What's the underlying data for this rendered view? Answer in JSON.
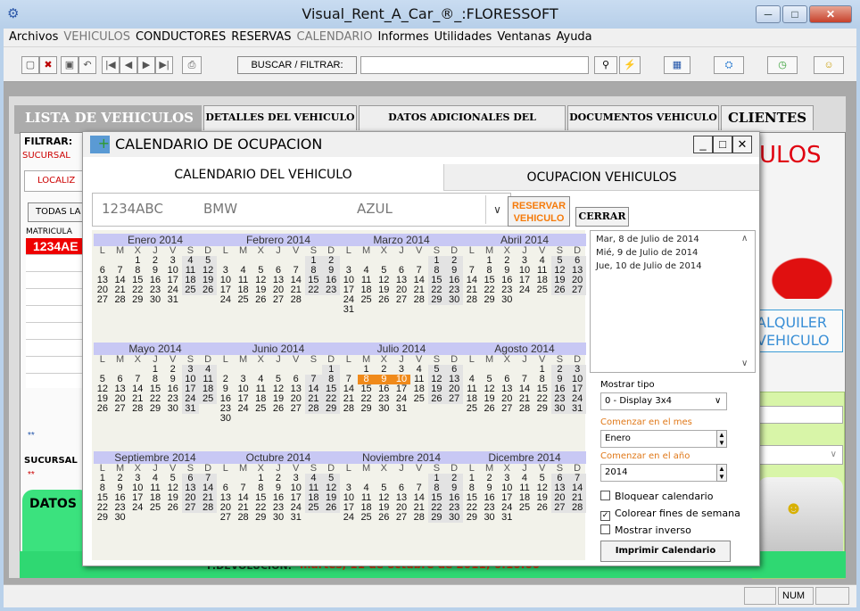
{
  "window": {
    "title": "Visual_Rent_A_Car_®_:FLORESSOFT",
    "min": "─",
    "max": "□",
    "close": "✕"
  },
  "menu": [
    {
      "label": "Archivos",
      "disabled": false
    },
    {
      "label": "VEHICULOS",
      "disabled": true
    },
    {
      "label": "CONDUCTORES",
      "disabled": false
    },
    {
      "label": "RESERVAS",
      "disabled": false
    },
    {
      "label": "CALENDARIO",
      "disabled": true
    },
    {
      "label": "Informes",
      "disabled": false
    },
    {
      "label": "Utilidades",
      "disabled": false
    },
    {
      "label": "Ventanas",
      "disabled": false
    },
    {
      "label": "Ayuda",
      "disabled": false
    }
  ],
  "toolbar": {
    "search_label": "BUSCAR / FILTRAR:",
    "search_value": ""
  },
  "tabs": {
    "main": "LISTA DE VEHICULOS",
    "t1": "DETALLES DEL VEHICULO",
    "t2": "DATOS ADICIONALES DEL VEHICULO",
    "t3": "DOCUMENTOS VEHICULO",
    "t4": "CLIENTES"
  },
  "left": {
    "filtrar": "FILTRAR:",
    "sucursal": "SUCURSAL",
    "localiz": "LOCALIZ",
    "todas": "TODAS LA",
    "matricula": "MATRICULA",
    "row1": "1234AE",
    "stars1": "**",
    "sucursal2": "SUCURSAL",
    "stars2": "**",
    "datos": "DATOS"
  },
  "right": {
    "title": "ULOS",
    "alquiler": "ALQUILER",
    "vehiculo": "VEHICULO"
  },
  "devolucion": {
    "label": "F.DEVOLUCION:",
    "value": "martes, 11 de octubre de 2011; 6:10:00"
  },
  "status": {
    "num": "NUM"
  },
  "dialog": {
    "title": "CALENDARIO DE OCUPACION",
    "tab1": "CALENDARIO DEL VEHICULO",
    "tab2": "OCUPACION VEHICULOS",
    "plate": "1234ABC",
    "brand": "BMW",
    "color": "AZUL",
    "reservar": "RESERVAR VEHICULO",
    "cerrar": "CERRAR",
    "dates": [
      "Mar, 8 de Julio de 2014",
      "Mié, 9 de Julio de 2014",
      "Jue, 10 de Julio de 2014"
    ],
    "mostrar_tipo": "Mostrar tipo",
    "display": "0 - Display 3x4",
    "comenzar_mes": "Comenzar en el mes",
    "mes": "Enero",
    "comenzar_anio": "Comenzar en el año",
    "anio": "2014",
    "bloquear": "Bloquear calendario",
    "colorear": "Colorear fines de semana",
    "inverso": "Mostrar inverso",
    "imprimir": "Imprimir Calendario",
    "weekdays": [
      "L",
      "M",
      "X",
      "J",
      "V",
      "S",
      "D"
    ],
    "months": [
      {
        "name": "Enero 2014",
        "offset": 2,
        "days": 31
      },
      {
        "name": "Febrero 2014",
        "offset": 5,
        "days": 28
      },
      {
        "name": "Marzo 2014",
        "offset": 5,
        "days": 31
      },
      {
        "name": "Abril 2014",
        "offset": 1,
        "days": 30
      },
      {
        "name": "Mayo 2014",
        "offset": 3,
        "days": 31
      },
      {
        "name": "Junio 2014",
        "offset": 6,
        "days": 30
      },
      {
        "name": "Julio 2014",
        "offset": 1,
        "days": 31,
        "selected": [
          8,
          9,
          10
        ]
      },
      {
        "name": "Agosto 2014",
        "offset": 4,
        "days": 31
      },
      {
        "name": "Septiembre 2014",
        "offset": 0,
        "days": 30
      },
      {
        "name": "Octubre 2014",
        "offset": 2,
        "days": 31
      },
      {
        "name": "Noviembre 2014",
        "offset": 5,
        "days": 30
      },
      {
        "name": "Dicembre 2014",
        "offset": 0,
        "days": 31
      }
    ]
  }
}
